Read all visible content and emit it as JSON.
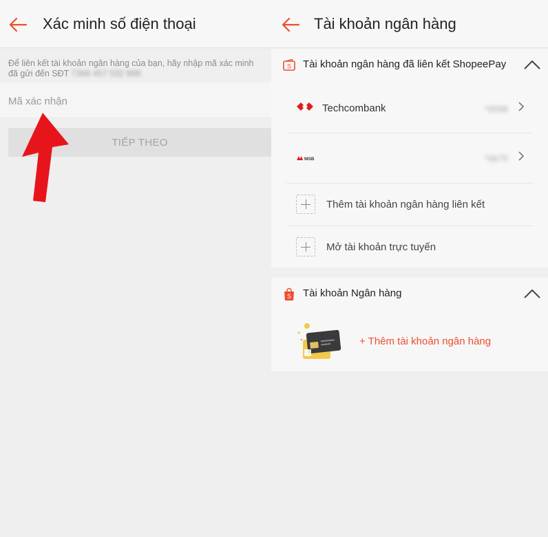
{
  "left": {
    "title": "Xác minh số điện thoại",
    "hint_text": "Để liên kết tài khoản ngân hàng của bạn, hãy nhập mã xác minh đã gửi đến SĐT",
    "hint_phone_masked": "7366 457 532 888",
    "code_placeholder": "Mã xác nhận",
    "code_value": "",
    "next_label": "TIẾP THEO"
  },
  "right": {
    "title": "Tài khoản ngân hàng",
    "linked_section": {
      "title": "Tài khoản ngân hàng đã liên kết ShopeePay",
      "banks": [
        {
          "name": "Techcombank",
          "account_masked": "*6598"
        },
        {
          "name": "",
          "logo_text": "MSB",
          "account_masked": "*6675"
        }
      ],
      "add_linked_label": "Thêm tài khoản ngân hàng liên kết",
      "open_online_label": "Mở tài khoản trực tuyến"
    },
    "bank_section": {
      "title": "Tài khoản Ngân hàng",
      "add_link": "+ Thêm tài khoản ngân hàng"
    }
  },
  "colors": {
    "accent": "#ee4d2d",
    "annotation_arrow": "#e8141b",
    "background": "#efefef",
    "surface": "#f7f7f7",
    "button_disabled": "#e0e0e0"
  },
  "icons": [
    "back-arrow-icon",
    "wallet-icon",
    "shopping-bag-icon",
    "chevron-up-icon",
    "chevron-right-icon",
    "plus-icon",
    "techcombank-logo-icon",
    "msb-logo-icon",
    "bank-card-illustration"
  ]
}
